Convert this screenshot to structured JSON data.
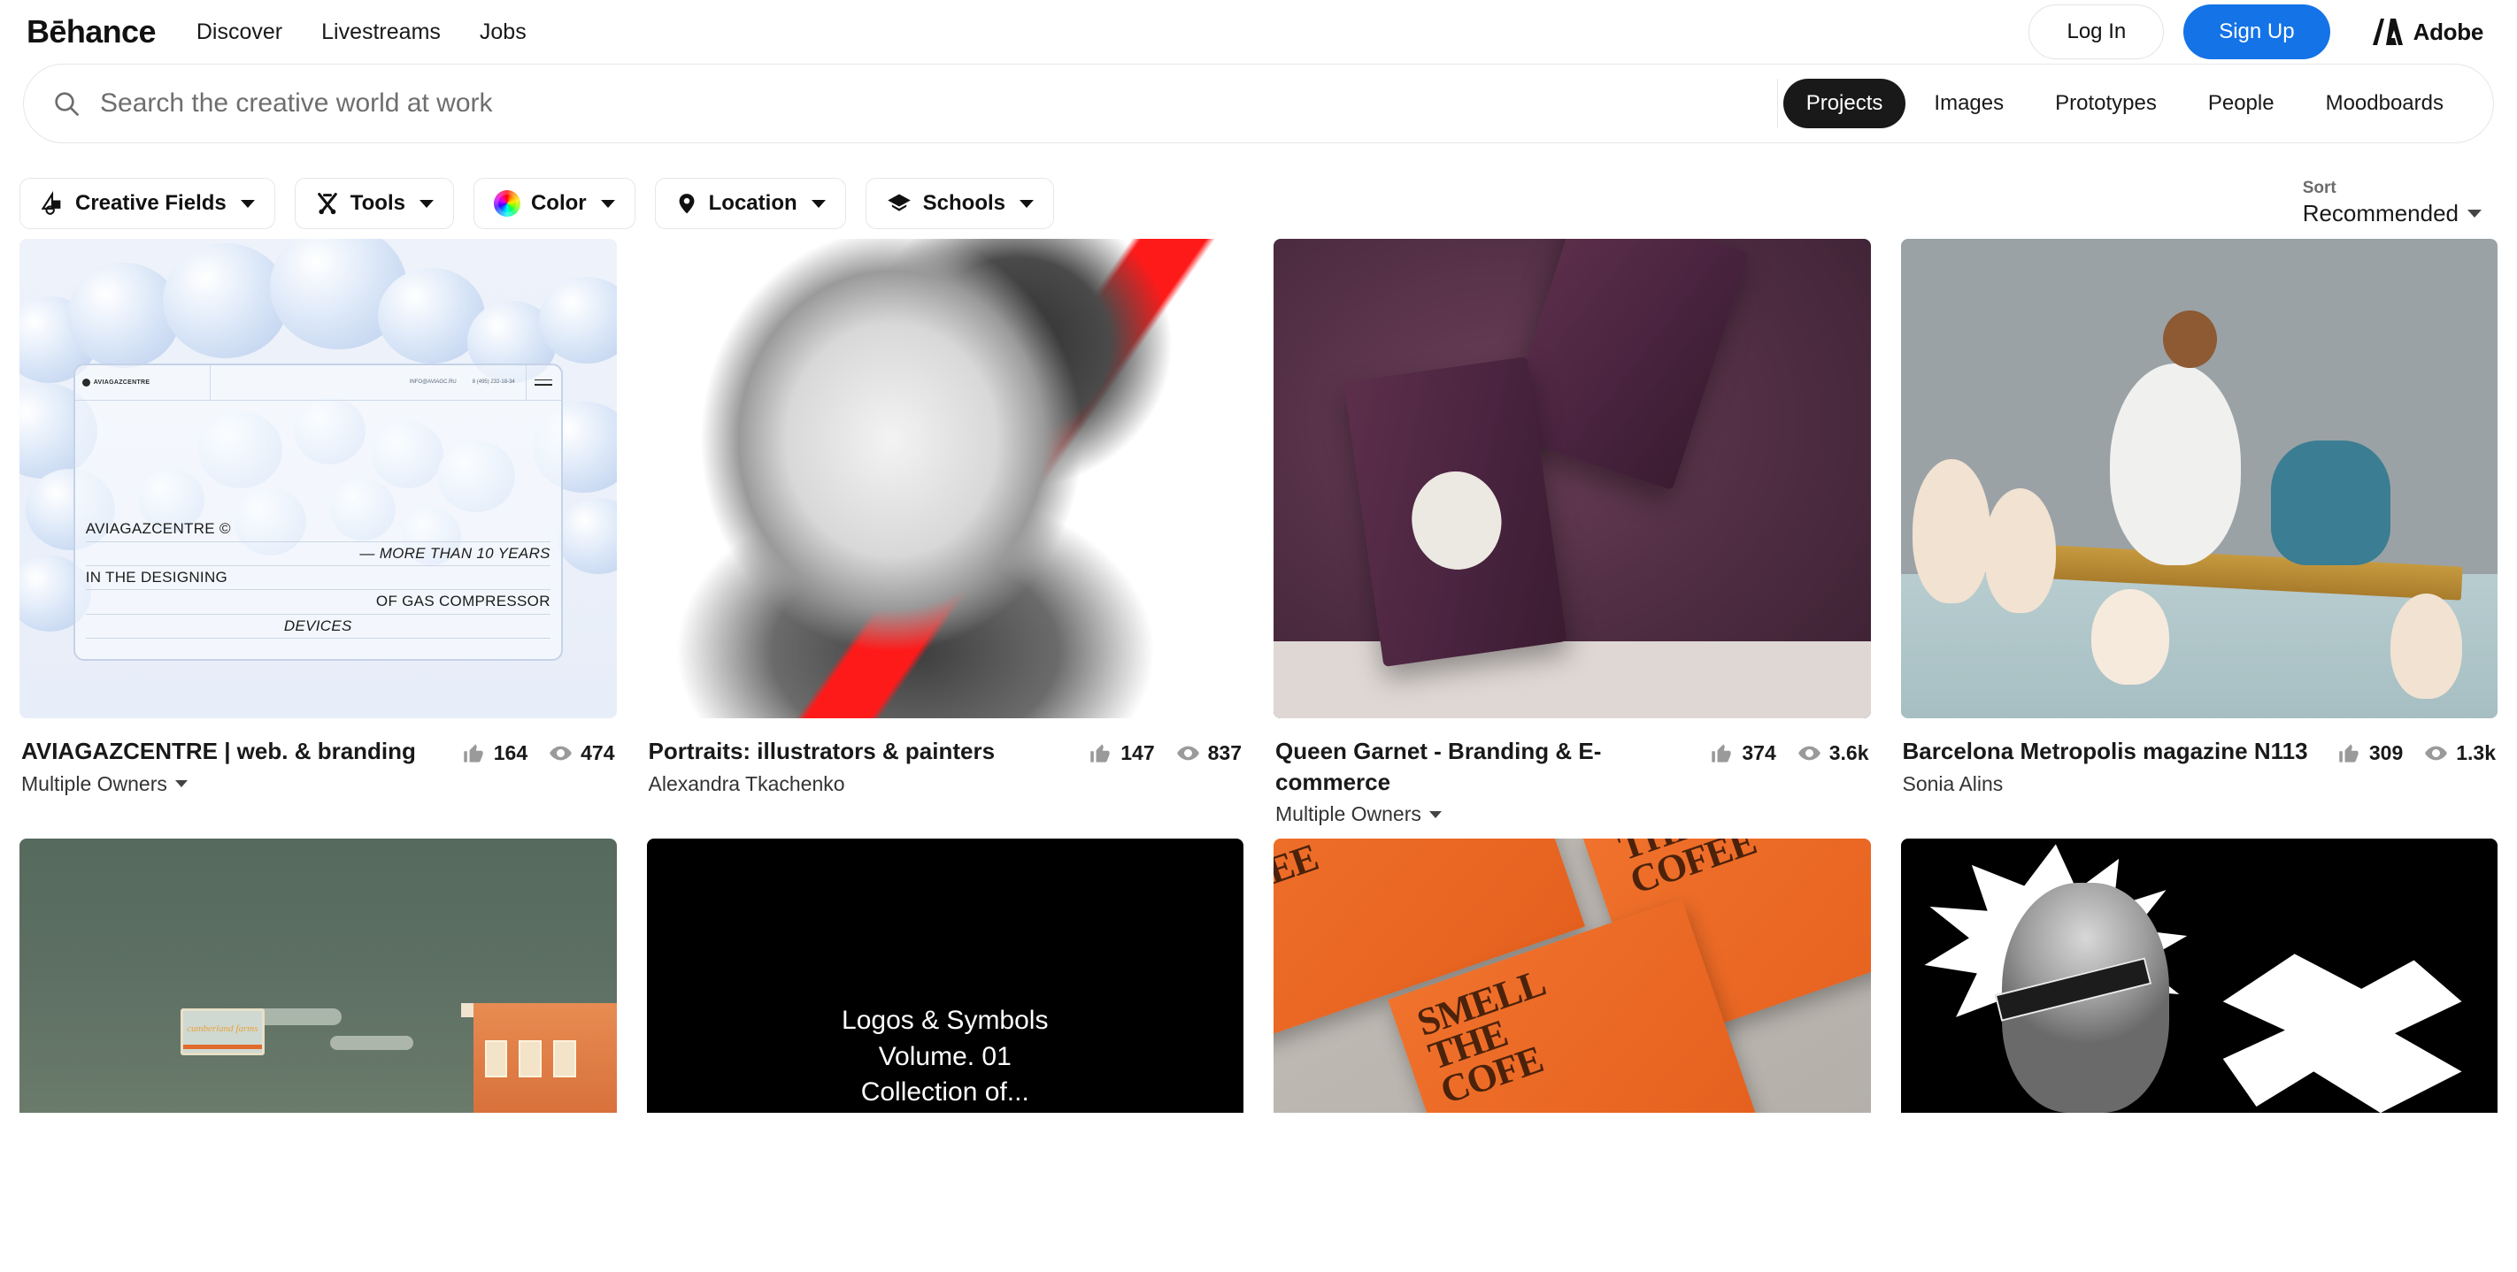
{
  "header": {
    "brand": "Bēhance",
    "nav": [
      {
        "label": "Discover",
        "name": "nav-discover"
      },
      {
        "label": "Livestreams",
        "name": "nav-livestreams"
      },
      {
        "label": "Jobs",
        "name": "nav-jobs"
      }
    ],
    "login_label": "Log In",
    "signup_label": "Sign Up",
    "adobe_label": "Adobe",
    "signup_color": "#1473e6"
  },
  "search": {
    "placeholder": "Search the creative world at work",
    "value": "",
    "icon": "search-icon",
    "scopes": [
      {
        "label": "Projects",
        "active": true
      },
      {
        "label": "Images",
        "active": false
      },
      {
        "label": "Prototypes",
        "active": false
      },
      {
        "label": "People",
        "active": false
      },
      {
        "label": "Moodboards",
        "active": false
      }
    ]
  },
  "filters": {
    "pills": [
      {
        "label": "Creative Fields",
        "icon": "creative-fields-icon"
      },
      {
        "label": "Tools",
        "icon": "tools-icon"
      },
      {
        "label": "Color",
        "icon": "color-wheel-icon"
      },
      {
        "label": "Location",
        "icon": "location-pin-icon"
      },
      {
        "label": "Schools",
        "icon": "schools-icon"
      }
    ],
    "sort_label": "Sort",
    "sort_value": "Recommended"
  },
  "projects": [
    {
      "title": "AVIAGAZCENTRE | web. & branding",
      "owner": "Multiple Owners",
      "owner_has_caret": true,
      "likes": "164",
      "views": "474",
      "artwork": {
        "headline_1": "AVIAGAZCENTRE ©",
        "headline_2": "— MORE THAN 10 YEARS",
        "headline_3": "IN THE DESIGNING",
        "headline_4": "OF GAS COMPRESSOR",
        "headline_5": "DEVICES",
        "brand": "AVIAGAZCENTRE",
        "email": "INFO@AVIAGC.RU",
        "phone": "8 (495) 232-18-34"
      }
    },
    {
      "title": "Portraits: illustrators & painters",
      "owner": "Alexandra Tkachenko",
      "owner_has_caret": false,
      "likes": "147",
      "views": "837"
    },
    {
      "title": "Queen Garnet - Branding & E-commerce",
      "owner": "Multiple Owners",
      "owner_has_caret": true,
      "likes": "374",
      "views": "3.6k"
    },
    {
      "title": "Barcelona Metropolis magazine N113",
      "owner": "Sonia Alins",
      "owner_has_caret": false,
      "likes": "309",
      "views": "1.3k"
    }
  ],
  "projects_row2": [
    {
      "artwork_text": "cumberland farms"
    },
    {
      "artwork_line1": "Logos & Symbols",
      "artwork_line2": "Volume. 01",
      "artwork_line3": "Collection of..."
    },
    {
      "artwork_text": "And SMELL THE COFFEE"
    },
    {
      "artwork_text": ""
    }
  ]
}
